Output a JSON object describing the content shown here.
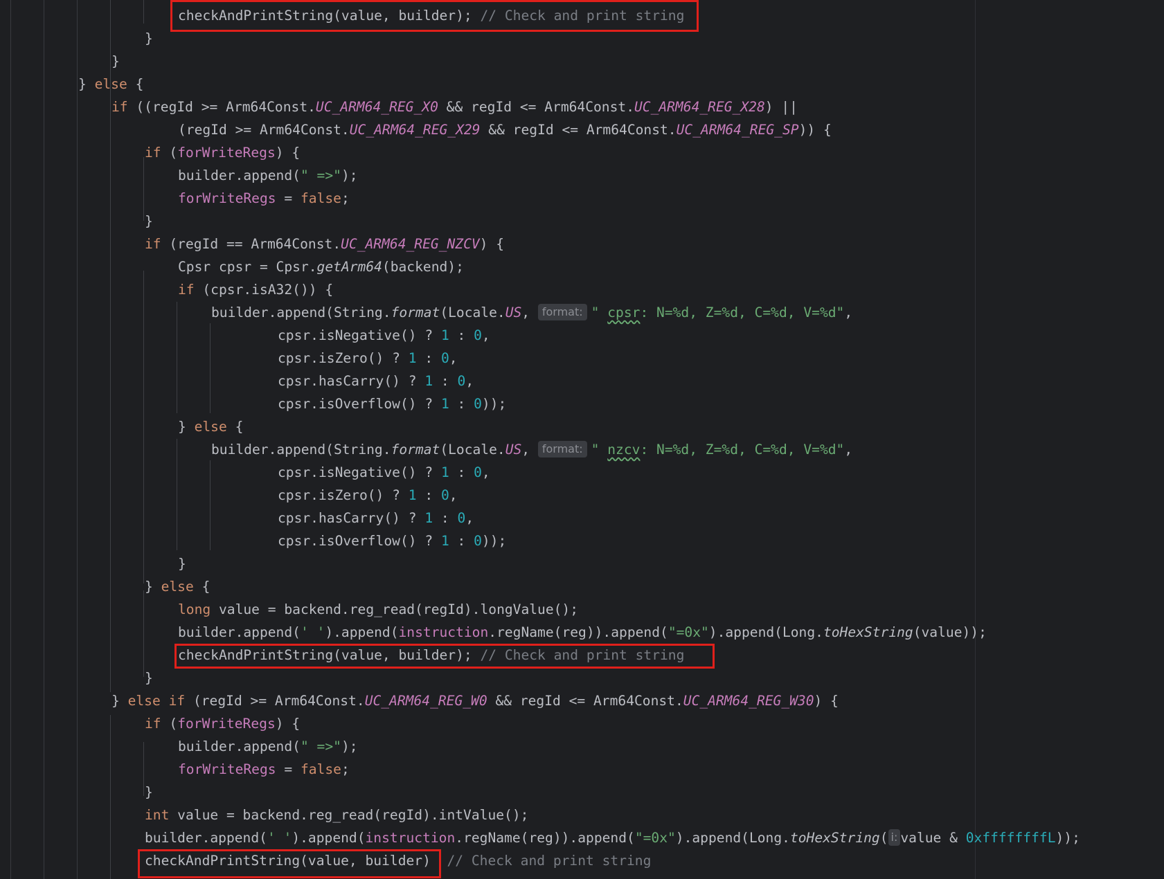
{
  "colors": {
    "background": "#1e1f22",
    "keyword": "#cf8e6d",
    "field": "#c77dbb",
    "string": "#6aab73",
    "number": "#2aacb8",
    "comment": "#7a7e85",
    "text": "#bcbec4",
    "highlight_box": "#e0201b"
  },
  "hints": {
    "format": "format:",
    "i": "i:"
  },
  "code": {
    "c1": "checkAndPrintString(value, builder);",
    "cm1": "// Check and print string",
    "l2": "}",
    "l3": "}",
    "l4a": "} ",
    "l4b": "else",
    "l4c": " {",
    "l5_if": "if",
    "l5_a": " ((regId >= Arm64Const.",
    "l5_c1": "UC_ARM64_REG_X0",
    "l5_b": " && regId <= Arm64Const.",
    "l5_c2": "UC_ARM64_REG_X28",
    "l5_c": ") ||",
    "l6_a": "(regId >= Arm64Const.",
    "l6_c1": "UC_ARM64_REG_X29",
    "l6_b": " && regId <= Arm64Const.",
    "l6_c2": "UC_ARM64_REG_SP",
    "l6_c": ")) {",
    "l7_if": "if",
    "l7_a": " (",
    "l7_f": "forWriteRegs",
    "l7_b": ") {",
    "l8_a": "builder.append(",
    "l8_s": "\" =>\"",
    "l8_b": ");",
    "l9_f": "forWriteRegs",
    "l9_a": " = ",
    "l9_k": "false",
    "l9_b": ";",
    "l10": "}",
    "l11_if": "if",
    "l11_a": " (regId == Arm64Const.",
    "l11_c": "UC_ARM64_REG_NZCV",
    "l11_b": ") {",
    "l12_a": "Cpsr cpsr = Cpsr.",
    "l12_m": "getArm64",
    "l12_b": "(backend);",
    "l13_if": "if",
    "l13_a": " (cpsr.isA32()) {",
    "l14_a": "builder.append(String.",
    "l14_m": "format",
    "l14_b": "(Locale.",
    "l14_c": "US",
    "l14_d": ", ",
    "l14_s1": "\" ",
    "l14_t": "cpsr",
    "l14_s2": ": N=%d, Z=%d, C=%d, V=%d\"",
    "l14_e": ",",
    "l15_a": "cpsr.isNegative() ? ",
    "l15_n1": "1",
    "l15_b": " : ",
    "l15_n2": "0",
    "l15_c": ",",
    "l16_a": "cpsr.isZero() ? ",
    "l16_n1": "1",
    "l16_b": " : ",
    "l16_n2": "0",
    "l16_c": ",",
    "l17_a": "cpsr.hasCarry() ? ",
    "l17_n1": "1",
    "l17_b": " : ",
    "l17_n2": "0",
    "l17_c": ",",
    "l18_a": "cpsr.isOverflow() ? ",
    "l18_n1": "1",
    "l18_b": " : ",
    "l18_n2": "0",
    "l18_c": "));",
    "l19_a": "} ",
    "l19_k": "else",
    "l19_b": " {",
    "l20_a": "builder.append(String.",
    "l20_m": "format",
    "l20_b": "(Locale.",
    "l20_c": "US",
    "l20_d": ", ",
    "l20_s1": "\" ",
    "l20_t": "nzcv",
    "l20_s2": ": N=%d, Z=%d, C=%d, V=%d\"",
    "l20_e": ",",
    "l21_a": "cpsr.isNegative() ? ",
    "l21_n1": "1",
    "l21_b": " : ",
    "l21_n2": "0",
    "l21_c": ",",
    "l22_a": "cpsr.isZero() ? ",
    "l22_n1": "1",
    "l22_b": " : ",
    "l22_n2": "0",
    "l22_c": ",",
    "l23_a": "cpsr.hasCarry() ? ",
    "l23_n1": "1",
    "l23_b": " : ",
    "l23_n2": "0",
    "l23_c": ",",
    "l24_a": "cpsr.isOverflow() ? ",
    "l24_n1": "1",
    "l24_b": " : ",
    "l24_n2": "0",
    "l24_c": "));",
    "l25": "}",
    "l26_a": "} ",
    "l26_k": "else",
    "l26_b": " {",
    "l27_k": "long",
    "l27_a": " value = backend.reg_read(regId).longValue();",
    "l28_a": "builder.append(",
    "l28_s1": "' '",
    "l28_b": ").append(",
    "l28_f": "instruction",
    "l28_c": ".regName(reg)).append(",
    "l28_s2": "\"=0x\"",
    "l28_d": ").append(Long.",
    "l28_m": "toHexString",
    "l28_e": "(value));",
    "c2": "checkAndPrintString(value, builder);",
    "cm2": "// Check and print string",
    "l30": "}",
    "l31_a": "} ",
    "l31_k1": "else",
    "l31_sp": " ",
    "l31_k2": "if",
    "l31_b": " (regId >= Arm64Const.",
    "l31_c1": "UC_ARM64_REG_W0",
    "l31_c": " && regId <= Arm64Const.",
    "l31_c2": "UC_ARM64_REG_W30",
    "l31_d": ") {",
    "l32_if": "if",
    "l32_a": " (",
    "l32_f": "forWriteRegs",
    "l32_b": ") {",
    "l33_a": "builder.append(",
    "l33_s": "\" =>\"",
    "l33_b": ");",
    "l34_f": "forWriteRegs",
    "l34_a": " = ",
    "l34_k": "false",
    "l34_b": ";",
    "l35": "}",
    "l36_k": "int",
    "l36_a": " value = backend.reg_read(regId).intValue();",
    "l37_a": "builder.append(",
    "l37_s1": "' '",
    "l37_b": ").append(",
    "l37_f": "instruction",
    "l37_c": ".regName(reg)).append(",
    "l37_s2": "\"=0x\"",
    "l37_d": ").append(Long.",
    "l37_m": "toHexString",
    "l37_e": "(",
    "l37_g": "value & ",
    "l37_n": "0xffffffffL",
    "l37_h": "));",
    "c3": "checkAndPrintString(value, builder)",
    "cm3": "// Check and print string"
  }
}
